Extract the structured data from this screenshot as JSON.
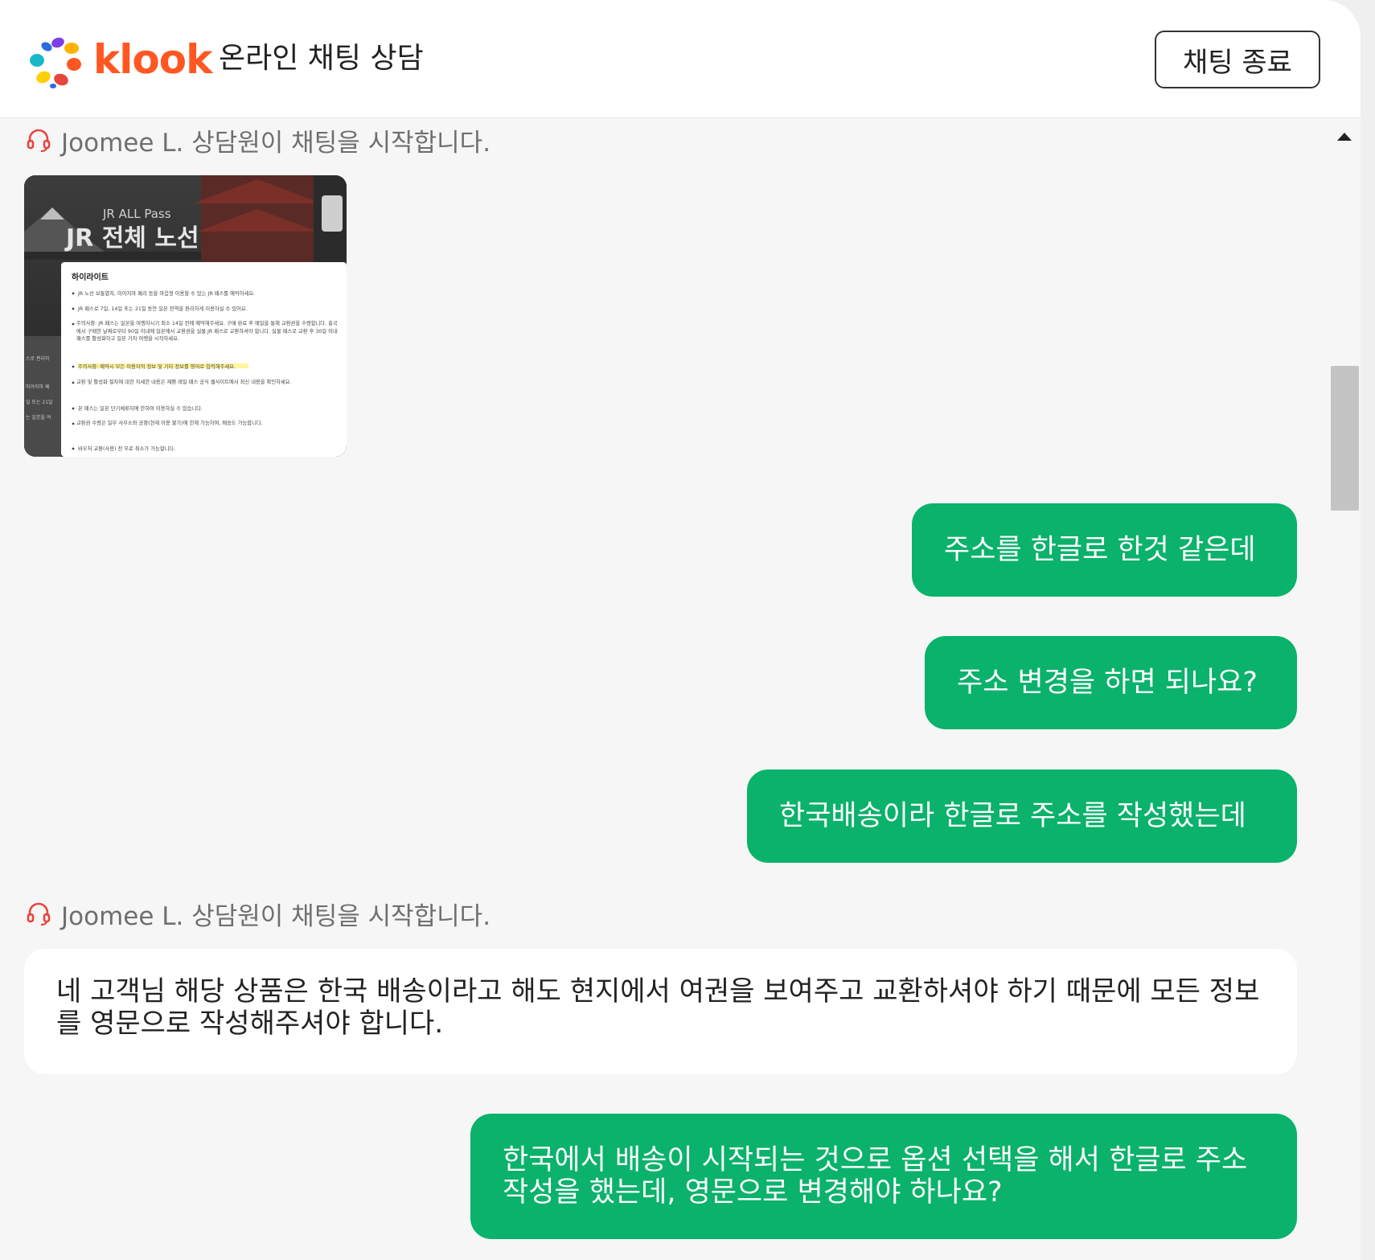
{
  "header": {
    "logo_text": "klook",
    "title": "온라인 채팅 상담",
    "end_chat_label": "채팅 종료"
  },
  "messages": [
    {
      "kind": "system",
      "text": "Joomee L. 상담원이 채팅을 시작합니다."
    },
    {
      "kind": "image",
      "image": {
        "hero_subtitle": "JR ALL Pass",
        "hero_title": "JR 전체 노선",
        "section_title": "하이라이트",
        "bullets": [
          "JR 노선 보통열차, 미야지마 페리 등을 마음껏 이용할 수 있는 JR 패스를 예약하세요.",
          "JR 패스로 7일, 14일 또는 21일 동안 일본 전역을 편리하게 이용하실 수 있어요.",
          "주의사항: JR 패스는 일본을 여행하시기 최소 14일 전에 예약해주세요. 구매 완료 후 메일을 통해 교환권을 수령합니다. 출국에서 구매한 날짜로부터 90일 이내에 일본에서 교환권을 실물 JR 패스로 교환하셔야 합니다. 실물 패스로 교환 후 30일 이내 패스를 활성화하고 일본 기차 여행을 시작하세요.",
          "주의사항: 예약시 모든 이용자의 정보 및 기타 정보를 영어로 입력해주세요.",
          "교환 및 활성화 절차에 대한 자세한 내용은 재팬 레일 패스 공식 웹사이트에서 최신 내용을 확인하세요.",
          "본 패스는 일본 단기체류자에 한하여 이용하실 수 있습니다.",
          "교환권 수령은 일부 사무소와 공항(현재 이용 불가)에 한해 가능하며, 배송도 가능합니다.",
          "바우처 교환(사용) 전 무료 취소가 가능합니다."
        ],
        "side_fragments": [
          "스로 편리하",
          "미야지마 페",
          "일 또는 21일",
          "는 일본을 여"
        ]
      }
    },
    {
      "kind": "user",
      "text": "주소를 한글로 한것 같은데"
    },
    {
      "kind": "user",
      "text": "주소 변경을 하면 되나요?"
    },
    {
      "kind": "user",
      "text": "한국배송이라 한글로 주소를 작성했는데"
    },
    {
      "kind": "system",
      "text": "Joomee L. 상담원이 채팅을 시작합니다."
    },
    {
      "kind": "agent",
      "text": "네 고객님 해당 상품은 한국 배송이라고 해도 현지에서 여권을 보여주고 교환하셔야 하기 때문에 모든 정보를 영문으로 작성해주셔야 합니다."
    },
    {
      "kind": "user",
      "text": "한국에서 배송이 시작되는 것으로 옵션 선택을 해서 한글로 주소 작성을 했는데, 영문으로 변경해야 하나요?"
    }
  ],
  "colors": {
    "brand": "#ff5722",
    "user_bubble": "#0ab26b",
    "agent_icon": "#e8453c"
  }
}
